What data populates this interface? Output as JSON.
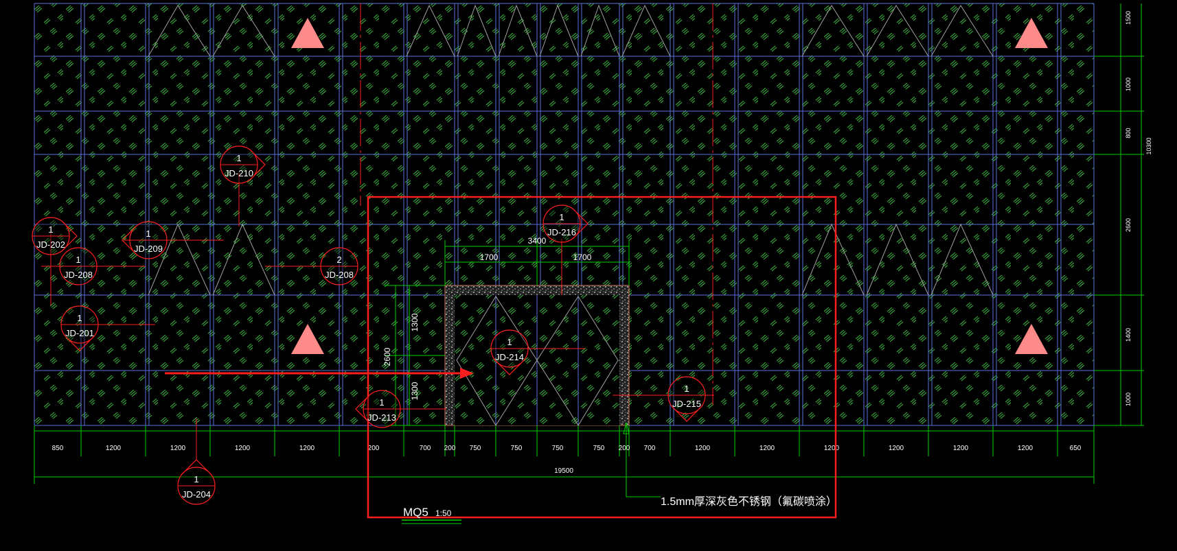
{
  "drawing": {
    "title": "MQ5",
    "scale": "1:50",
    "note": "1.5mm厚深灰色不锈钢（氟碳喷涂）"
  },
  "dimensions": {
    "bottom_segments": [
      "850",
      "1200",
      "1200",
      "1200",
      "1200",
      "200",
      "700",
      "200",
      "750",
      "750",
      "750",
      "750",
      "200",
      "700",
      "1200",
      "1200",
      "1200",
      "1200",
      "1200",
      "1200",
      "650"
    ],
    "bottom_total": "19500",
    "right_segments": [
      "1500",
      "1000",
      "800",
      "2600",
      "1400",
      "1000"
    ],
    "right_total": "10300",
    "door_total": "3400",
    "door_left_half": "1700",
    "door_right_half": "1700",
    "left_upper": "1300",
    "left_lower": "1300",
    "left_total": "2600"
  },
  "callouts": [
    {
      "id": "jd-210",
      "num": "1",
      "code": "JD-210"
    },
    {
      "id": "jd-202",
      "num": "1",
      "code": "JD-202"
    },
    {
      "id": "jd-209",
      "num": "1",
      "code": "JD-209"
    },
    {
      "id": "jd-208a",
      "num": "1",
      "code": "JD-208"
    },
    {
      "id": "jd-208b",
      "num": "2",
      "code": "JD-208"
    },
    {
      "id": "jd-201",
      "num": "1",
      "code": "JD-201"
    },
    {
      "id": "jd-216",
      "num": "1",
      "code": "JD-216"
    },
    {
      "id": "jd-214",
      "num": "1",
      "code": "JD-214"
    },
    {
      "id": "jd-213",
      "num": "1",
      "code": "JD-213"
    },
    {
      "id": "jd-215",
      "num": "1",
      "code": "JD-215"
    },
    {
      "id": "jd-204",
      "num": "1",
      "code": "JD-204"
    }
  ],
  "colors": {
    "background": "#000000",
    "grid": "#5a6fd8",
    "hatch": "#3fbf3f",
    "dimension": "#00d000",
    "callout": "#ff2020",
    "marker": "#ff8a8a",
    "frame": "#ff1e1e"
  }
}
